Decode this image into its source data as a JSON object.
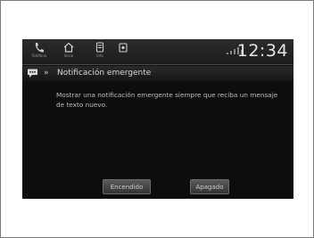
{
  "statusbar": {
    "icons": [
      {
        "name": "phone-icon",
        "caption": "Teléfono"
      },
      {
        "name": "home-icon",
        "caption": "Inicio"
      },
      {
        "name": "media-icon",
        "caption": "Info"
      },
      {
        "name": "audio-icon",
        "caption": ""
      }
    ],
    "clock": "12:34"
  },
  "titlebar": {
    "chevron": "»",
    "title": "Notificación emergente"
  },
  "message": "Mostrar una notificación emergente siempre que reciba un mensaje de texto nuevo.",
  "buttons": {
    "on_label": "Encendido",
    "off_label": "Apagado"
  },
  "colors": {
    "screen_bg": "#0d0d0d",
    "text": "#bdbdbd",
    "button": "#4a4a4a"
  }
}
